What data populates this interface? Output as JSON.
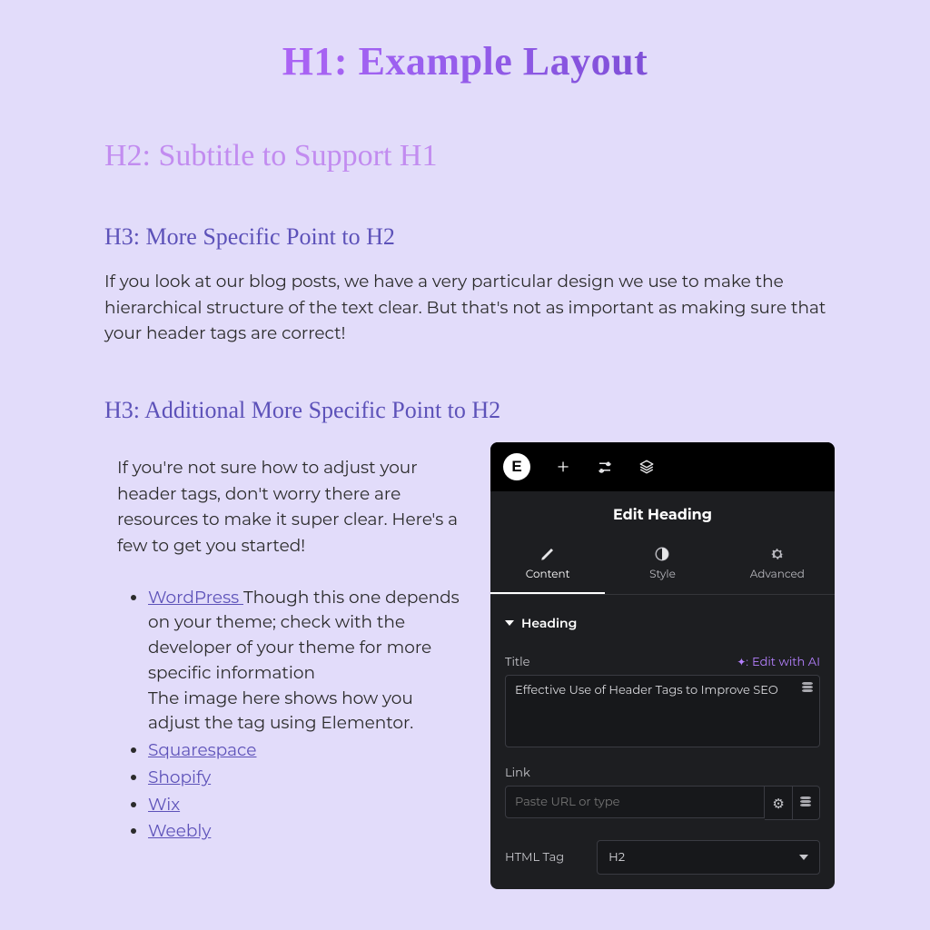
{
  "headings": {
    "h1": "H1: Example Layout",
    "h2": "H2: Subtitle to Support H1",
    "h3a": "H3: More Specific Point to H2",
    "h3b": "H3: Additional More Specific Point to H2"
  },
  "body": {
    "p1": "If you look at our blog posts, we have a very particular design we use to make the hierarchical structure of the text clear. But that's not as important as making sure that your header tags are correct!",
    "p2": "If you're not sure how to adjust your header tags, don't worry there are resources to make it super clear. Here's a few to get you started!"
  },
  "list": {
    "wordpress": {
      "link": "WordPress ",
      "after": "Though this one depends on your theme; check with the developer of your theme for more specific information",
      "line2": "The image here shows how you adjust the tag using Elementor."
    },
    "items": [
      "Squarespace",
      "Shopify",
      "Wix",
      "Weebly"
    ]
  },
  "panel": {
    "title": "Edit Heading",
    "tabs": {
      "content": "Content",
      "style": "Style",
      "advanced": "Advanced"
    },
    "section": "Heading",
    "title_label": "Title",
    "edit_ai": "Edit with AI",
    "title_value": "Effective Use of Header Tags to Improve SEO",
    "link_label": "Link",
    "link_placeholder": "Paste URL or type",
    "htmltag_label": "HTML Tag",
    "htmltag_value": "H2"
  }
}
